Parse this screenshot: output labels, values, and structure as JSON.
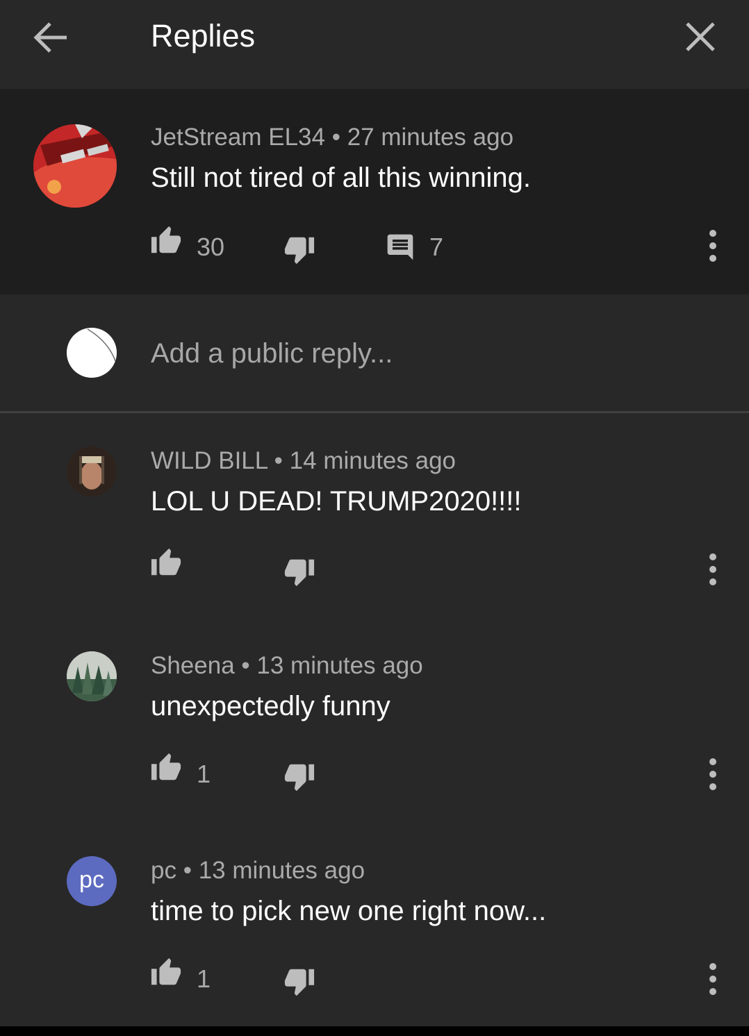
{
  "header": {
    "title": "Replies",
    "back_icon": "arrow-left-icon",
    "close_icon": "close-icon"
  },
  "parent_comment": {
    "author": "JetStream EL34",
    "time": "27 minutes ago",
    "text": "Still not tired of all this winning.",
    "likes": "30",
    "replies": "7"
  },
  "reply_box": {
    "placeholder": "Add a public reply..."
  },
  "replies": [
    {
      "author": "WILD BILL",
      "time": "14 minutes ago",
      "text": "LOL U DEAD!  TRUMP2020!!!!",
      "likes": ""
    },
    {
      "author": "Sheena",
      "time": "13 minutes ago",
      "text": "unexpectedly funny",
      "likes": "1"
    },
    {
      "author": "pc",
      "time": "13 minutes ago",
      "text": "time to pick new one right now...",
      "likes": "1",
      "avatar_initials": "pc"
    }
  ],
  "separator": "•",
  "colors": {
    "background": "#282828",
    "parent_background": "#1e1e1e",
    "text_primary": "#ffffff",
    "text_secondary": "#aaaaaa",
    "pc_avatar": "#5c6bc0"
  }
}
